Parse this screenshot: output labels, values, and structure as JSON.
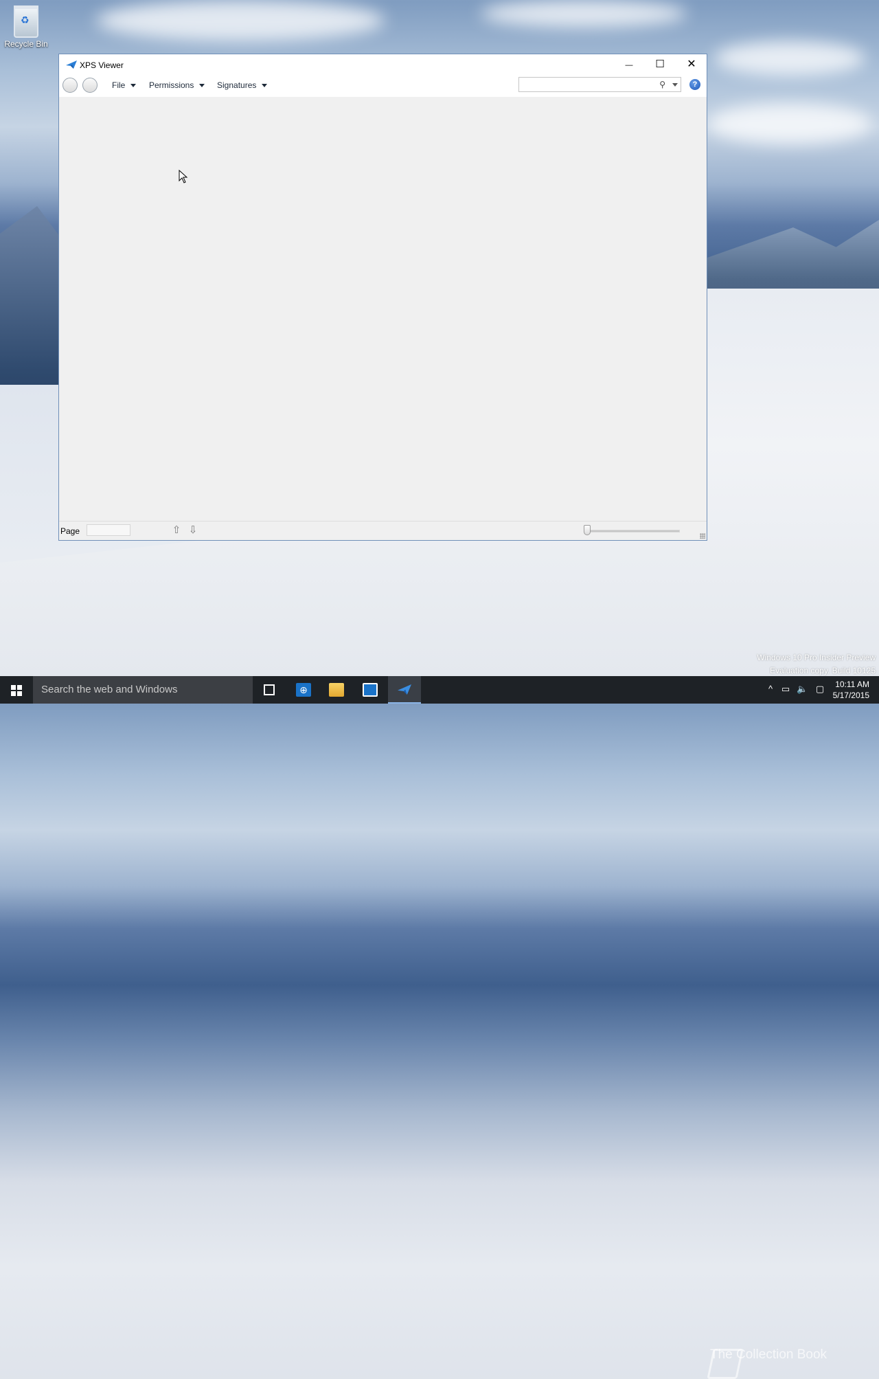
{
  "desktop": {
    "recycle_bin_label": "Recycle Bin",
    "watermark_line1": "Windows 10 Pro Insider Preview",
    "watermark_line2": "Evaluation copy. Build 10125",
    "overlay_brand": "The Collection Book"
  },
  "window": {
    "title": "XPS Viewer",
    "controls": {
      "minimize": "—",
      "maximize": "☐",
      "close": "✕"
    },
    "menus": [
      {
        "label": "File"
      },
      {
        "label": "Permissions"
      },
      {
        "label": "Signatures"
      }
    ],
    "search": {
      "value": "",
      "placeholder": ""
    },
    "help_label": "?",
    "status": {
      "page_label": "Page",
      "page_value": ""
    }
  },
  "taskbar": {
    "search_placeholder": "Search the web and Windows",
    "time": "10:11 AM",
    "date": "5/17/2015"
  },
  "icons": {
    "prev": "up-arrow-icon",
    "next": "down-arrow-icon"
  }
}
